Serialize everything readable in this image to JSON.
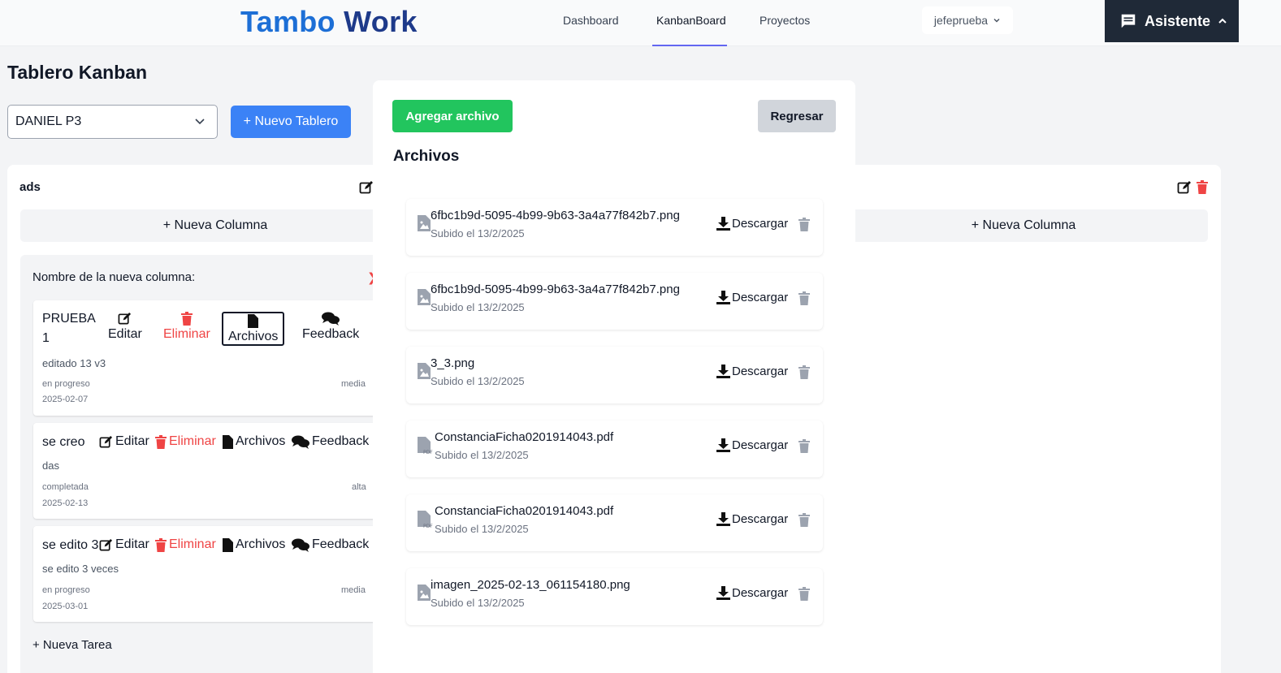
{
  "header": {
    "logo_part1": "Tambo",
    "logo_part2": "Work",
    "nav": [
      "Dashboard",
      "KanbanBoard",
      "Proyectos"
    ],
    "active_nav": "KanbanBoard",
    "user": "jefeprueba",
    "assistant_label": "Asistente"
  },
  "page": {
    "title": "Tablero Kanban",
    "selected_board": "DANIEL P3",
    "new_board_label": "+ Nuevo Tablero"
  },
  "column": {
    "name": "ads",
    "new_column_label": "+ Nueva Columna",
    "new_column_prompt": "Nombre de la nueva columna:",
    "new_task_label": "+ Nueva Tarea"
  },
  "task_actions": {
    "edit": "Editar",
    "delete": "Eliminar",
    "files": "Archivos",
    "feedback": "Feedback"
  },
  "tasks": [
    {
      "title_line1": "PRUEBA",
      "title_line2": "1",
      "description": "editado 13 v3",
      "status": "en progreso",
      "priority": "media",
      "date": "2025-02-07"
    },
    {
      "title": "se creo",
      "description": "das",
      "status": "completada",
      "priority": "alta",
      "date": "2025-02-13"
    },
    {
      "title": "se edito 3",
      "description": "se edito 3 veces",
      "status": "en progreso",
      "priority": "media",
      "date": "2025-03-01"
    }
  ],
  "files_panel": {
    "add_label": "Agregar archivo",
    "back_label": "Regresar",
    "title": "Archivos",
    "download_label": "Descargar",
    "files": [
      {
        "name": "6fbc1b9d-5095-4b99-9b63-3a4a77f842b7.png",
        "uploaded": "Subido el 13/2/2025",
        "type": "image"
      },
      {
        "name": "6fbc1b9d-5095-4b99-9b63-3a4a77f842b7.png",
        "uploaded": "Subido el 13/2/2025",
        "type": "image"
      },
      {
        "name": "3_3.png",
        "uploaded": "Subido el 13/2/2025",
        "type": "image"
      },
      {
        "name": "ConstanciaFicha0201914043.pdf",
        "uploaded": "Subido el 13/2/2025",
        "type": "pdf"
      },
      {
        "name": "ConstanciaFicha0201914043.pdf",
        "uploaded": "Subido el 13/2/2025",
        "type": "pdf"
      },
      {
        "name": "imagen_2025-02-13_061154180.png",
        "uploaded": "Subido el 13/2/2025",
        "type": "image"
      }
    ]
  },
  "colors": {
    "primary_blue": "#3b82f6",
    "success_green": "#22c55e",
    "danger_red": "#ef4444",
    "dark_panel": "#1f2937"
  }
}
